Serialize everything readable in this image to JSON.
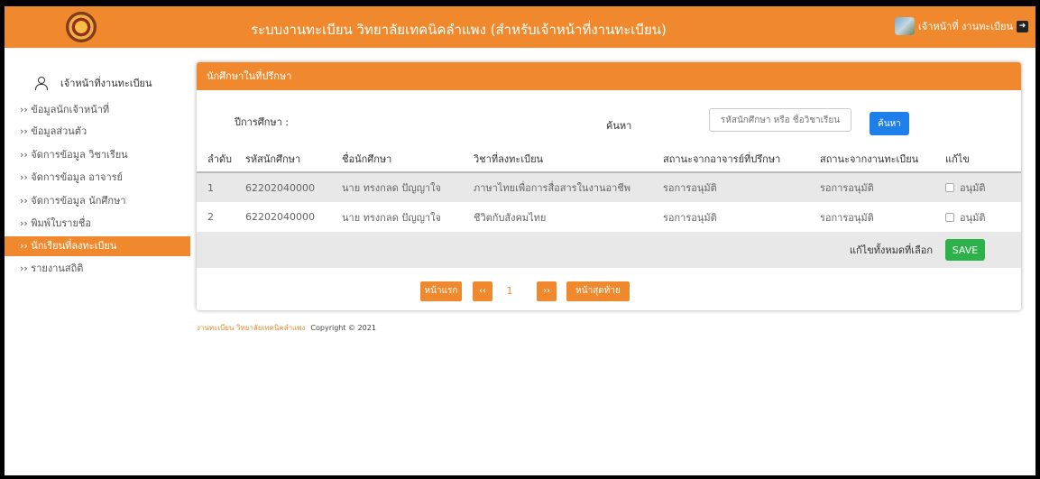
{
  "header": {
    "title": "ระบบงานทะเบียน วิทยาลัยเทคนิคลำแพง (สำหรับเจ้าหน้าที่งานทะเบียน)",
    "user": "เจ้าหน้าที่ งานทะเบียน",
    "brand_color": "#f0892d"
  },
  "sidebar": {
    "user": "เจ้าหน้าที่งานทะเบียน",
    "items": [
      {
        "label": "›› ข้อมูลนักเจ้าหน้าที่"
      },
      {
        "label": "›› ข้อมูลส่วนตัว"
      },
      {
        "label": "›› จัดการข้อมูล วิชาเรียน"
      },
      {
        "label": "›› จัดการข้อมูล อาจารย์"
      },
      {
        "label": "›› จัดการข้อมูล นักศึกษา"
      },
      {
        "label": "›› พิมพ์ใบรายชื่อ"
      },
      {
        "label": "›› นักเรียนที่ลงทะเบียน",
        "active": true
      },
      {
        "label": "›› รายงานสถิติ"
      }
    ]
  },
  "panel": {
    "title": "นักศึกษาในที่ปรึกษา",
    "year_label": "ปีการศึกษา :",
    "search_label": "ค้นหา",
    "search_placeholder": "รหัสนักศึกษา หรือ ชื่อวิชาเรียน",
    "search_button": "ค้นหา",
    "columns": [
      "ลำดับ",
      "รหัสนักศึกษา",
      "ชื่อนักศึกษา",
      "วิชาที่ลงทะเบียน",
      "สถานะจากอาจารย์ที่ปรึกษา",
      "สถานะจากงานทะเบียน",
      "แก้ไข"
    ],
    "rows": [
      {
        "no": "1",
        "id": "62202040000",
        "name": "นาย ทรงกลด ปัญญาใจ",
        "subject": "ภาษาไทยเพื่อการสื่อสารในงานอาชีพ",
        "advisor_status": "รอการอนุมัติ",
        "registrar_status": "รอการอนุมัติ",
        "approve": "อนุมัติ"
      },
      {
        "no": "2",
        "id": "62202040000",
        "name": "นาย ทรงกลด ปัญญาใจ",
        "subject": "ชีวิตกับสังคมไทย",
        "advisor_status": "รอการอนุมัติ",
        "registrar_status": "รอการอนุมัติ",
        "approve": "อนุมัติ"
      }
    ],
    "edit_all_label": "แก้ไขทั้งหมดที่เลือก",
    "save_button": "SAVE"
  },
  "pagination": {
    "first": "หน้าแรก",
    "prev": "‹‹",
    "current": "1",
    "next": "››",
    "last": "หน้าสุดท้าย"
  },
  "footer": {
    "org": "งานทะเบียน วิทยาลัยเทคนิคลำแพง",
    "copyright": "Copyright © 2021"
  }
}
